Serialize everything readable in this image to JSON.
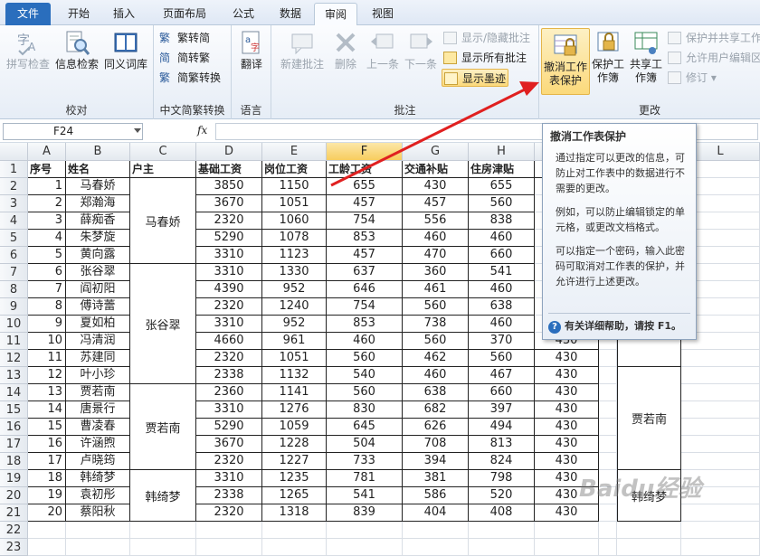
{
  "tabs": [
    "文件",
    "开始",
    "插入",
    "页面布局",
    "公式",
    "数据",
    "审阅",
    "视图"
  ],
  "ribbon": {
    "proof": {
      "label": "校对",
      "spell": "拼写检查",
      "research": "信息检索",
      "thesaurus": "同义词库"
    },
    "chinese": {
      "label": "中文简繁转换",
      "t2s": "繁转简",
      "s2t": "简转繁",
      "conv": "简繁转换"
    },
    "lang": {
      "label": "语言",
      "translate": "翻译"
    },
    "comments": {
      "label": "批注",
      "new": "新建批注",
      "delete": "删除",
      "prev": "上一条",
      "next": "下一条",
      "showhide": "显示/隐藏批注",
      "showall": "显示所有批注",
      "ink": "显示墨迹"
    },
    "changes": {
      "label": "更改",
      "unprotect": "撤消工作表保护",
      "protectbook": "保护工作簿",
      "sharebook": "共享工作簿",
      "protshare": "保护并共享工作",
      "allowedit": "允许用户编辑区",
      "track": "修订"
    }
  },
  "formula": {
    "cellref": "F24",
    "fx": "fx"
  },
  "columns": [
    "A",
    "B",
    "C",
    "D",
    "E",
    "F",
    "G",
    "H",
    "I",
    "J",
    "K",
    "L"
  ],
  "headers": [
    "序号",
    "姓名",
    "户主",
    "基础工资",
    "岗位工资",
    "工龄工资",
    "交通补贴",
    "住房津贴"
  ],
  "rows": [
    [
      "1",
      "马春娇",
      "3850",
      "1150",
      "655",
      "430",
      "655"
    ],
    [
      "2",
      "郑瀚海",
      "3670",
      "1051",
      "457",
      "457",
      "560"
    ],
    [
      "3",
      "薛痴香",
      "2320",
      "1060",
      "754",
      "556",
      "838"
    ],
    [
      "4",
      "朱梦旋",
      "5290",
      "1078",
      "853",
      "460",
      "460"
    ],
    [
      "5",
      "黄向露",
      "3310",
      "1123",
      "457",
      "470",
      "660"
    ],
    [
      "6",
      "张谷翠",
      "3310",
      "1330",
      "637",
      "360",
      "541"
    ],
    [
      "7",
      "阎初阳",
      "4390",
      "952",
      "646",
      "461",
      "460"
    ],
    [
      "8",
      "傅诗蕾",
      "2320",
      "1240",
      "754",
      "560",
      "638"
    ],
    [
      "9",
      "夏如柏",
      "3310",
      "952",
      "853",
      "738",
      "460"
    ],
    [
      "10",
      "冯清润",
      "4660",
      "961",
      "460",
      "560",
      "370"
    ],
    [
      "11",
      "苏建同",
      "2320",
      "1051",
      "560",
      "462",
      "560"
    ],
    [
      "12",
      "叶小珍",
      "2338",
      "1132",
      "540",
      "460",
      "467"
    ],
    [
      "13",
      "贾若南",
      "2360",
      "1141",
      "560",
      "638",
      "660"
    ],
    [
      "14",
      "唐景行",
      "3310",
      "1276",
      "830",
      "682",
      "397"
    ],
    [
      "15",
      "曹凌春",
      "5290",
      "1059",
      "645",
      "626",
      "494"
    ],
    [
      "16",
      "许涵煦",
      "3670",
      "1228",
      "504",
      "708",
      "813"
    ],
    [
      "17",
      "卢晓筠",
      "2320",
      "1227",
      "733",
      "394",
      "824"
    ],
    [
      "18",
      "韩绮梦",
      "3310",
      "1235",
      "781",
      "381",
      "798"
    ],
    [
      "19",
      "袁初彤",
      "2338",
      "1265",
      "541",
      "586",
      "520"
    ],
    [
      "20",
      "蔡阳秋",
      "2320",
      "1318",
      "839",
      "404",
      "408"
    ]
  ],
  "households": [
    "马春娇",
    "张谷翠",
    "贾若南",
    "韩绮梦"
  ],
  "col_i": [
    "430",
    "430",
    "430",
    "430",
    "430",
    "430",
    "430",
    "430",
    "430",
    "430",
    "430"
  ],
  "k_merged": [
    "贾若南",
    "韩绮梦"
  ],
  "tooltip": {
    "title": "撤消工作表保护",
    "p1": "通过指定可以更改的信息，可防止对工作表中的数据进行不需要的更改。",
    "p2": "例如，可以防止编辑锁定的单元格，或更改文档格式。",
    "p3": "可以指定一个密码，输入此密码可取消对工作表的保护，并允许进行上述更改。",
    "help": "有关详细帮助，请按 F1。"
  },
  "watermark": "Baidu经验"
}
